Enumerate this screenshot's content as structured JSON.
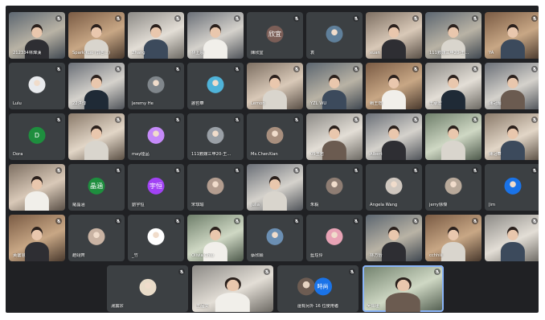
{
  "colors": {
    "background": "#202124",
    "tile": "#3c4043",
    "active_outline": "#8ab4f8"
  },
  "participants": [
    {
      "name": "212334林煒漢",
      "type": "video"
    },
    {
      "name": "Spark Kuo (郭哲...)",
      "type": "video"
    },
    {
      "name": "Zhang",
      "type": "video"
    },
    {
      "name": "林上恩",
      "type": "video"
    },
    {
      "name": "陳欣宜",
      "type": "avatar",
      "avatar_text": "欣宜",
      "avatar_color": "#7b5e57"
    },
    {
      "name": "袁",
      "type": "avatar",
      "avatar_text": "",
      "avatar_color": "#5f7f9a"
    },
    {
      "name": "xuan",
      "type": "video"
    },
    {
      "name": "111數媒三甲20-王...",
      "type": "video"
    },
    {
      "name": "YA",
      "type": "video"
    },
    {
      "name": "Lulu",
      "type": "avatar",
      "avatar_text": "",
      "avatar_color": "#e8eaed"
    },
    {
      "name": "22洪博",
      "type": "video"
    },
    {
      "name": "Jeremy He",
      "type": "avatar",
      "avatar_text": "",
      "avatar_color": "#80868b"
    },
    {
      "name": "謝哲華",
      "type": "avatar",
      "avatar_text": "",
      "avatar_color": "#4fb3d9"
    },
    {
      "name": "Lemon",
      "type": "video"
    },
    {
      "name": "YZL WU",
      "type": "video"
    },
    {
      "name": "賴王瑄",
      "type": "video"
    },
    {
      "name": "王承宏",
      "type": "video"
    },
    {
      "name": "陳冠翰",
      "type": "video"
    },
    {
      "name": "Dora",
      "type": "avatar",
      "avatar_text": "D",
      "avatar_color": "#1e8e3e"
    },
    {
      "name": "",
      "type": "video"
    },
    {
      "name": "may陸品",
      "type": "avatar",
      "avatar_text": "",
      "avatar_color": "#c58af9"
    },
    {
      "name": "111數媒三甲20-王...",
      "type": "avatar",
      "avatar_text": "",
      "avatar_color": "#9aa0a6"
    },
    {
      "name": "Ms.ChenXian",
      "type": "avatar",
      "avatar_text": "",
      "avatar_color": "#a88f7e"
    },
    {
      "name": "05王若",
      "type": "video"
    },
    {
      "name": "Albert",
      "type": "video"
    },
    {
      "name": "",
      "type": "video"
    },
    {
      "name": "陳冠華",
      "type": "video"
    },
    {
      "name": "",
      "type": "video"
    },
    {
      "name": "羅晶涵",
      "type": "avatar",
      "avatar_text": "晶涵",
      "avatar_color": "#1e8e3e"
    },
    {
      "name": "劉宇恒",
      "type": "avatar",
      "avatar_text": "宇恒",
      "avatar_color": "#a142f4"
    },
    {
      "name": "宋琪瑜",
      "type": "avatar",
      "avatar_text": "",
      "avatar_color": "#b39d8f"
    },
    {
      "name": "Julia",
      "type": "video"
    },
    {
      "name": "朱毅",
      "type": "avatar",
      "avatar_text": "",
      "avatar_color": "#8e7d73"
    },
    {
      "name": "Angela Wang",
      "type": "avatar",
      "avatar_text": "",
      "avatar_color": "#cfc7bf"
    },
    {
      "name": "jerry徐傑",
      "type": "avatar",
      "avatar_text": "",
      "avatar_color": "#b8a99a"
    },
    {
      "name": "Jim",
      "type": "avatar",
      "avatar_text": "",
      "avatar_color": "#1a73e8"
    },
    {
      "name": "黃馨慧",
      "type": "video"
    },
    {
      "name": "趙翊齊",
      "type": "avatar",
      "avatar_text": "",
      "avatar_color": "#c9b3a3"
    },
    {
      "name": "_竹",
      "type": "avatar",
      "avatar_text": "",
      "avatar_color": "#ffffff"
    },
    {
      "name": "Olivia Chiu",
      "type": "video"
    },
    {
      "name": "蔡欣穎",
      "type": "avatar",
      "avatar_text": "",
      "avatar_color": "#6b8fb3"
    },
    {
      "name": "藍珏伶",
      "type": "avatar",
      "avatar_text": "",
      "avatar_color": "#e8a3b5"
    },
    {
      "name": "林方怡",
      "type": "video"
    },
    {
      "name": "cchhiii",
      "type": "video"
    },
    {
      "name": "",
      "type": "video"
    }
  ],
  "bottom_row": [
    {
      "name": "湯震宗",
      "type": "avatar",
      "avatar_text": "",
      "avatar_color": "#e9dcc9"
    },
    {
      "name": "王品文",
      "type": "video"
    },
    {
      "name": "還有另外 16 位使用者",
      "type": "group",
      "avatar_text": "時尚"
    },
    {
      "name": "吳茹瑾",
      "type": "video",
      "active": true
    }
  ]
}
